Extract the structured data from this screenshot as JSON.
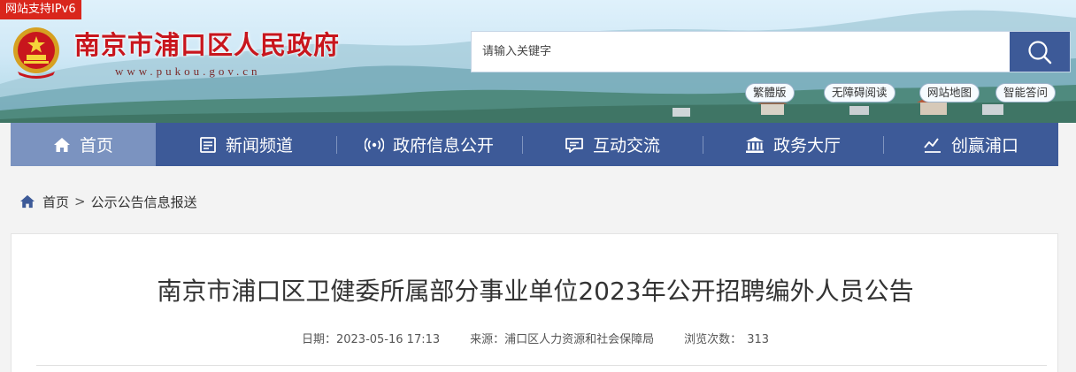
{
  "badge": {
    "ipv6": "网站支持IPv6"
  },
  "site": {
    "title": "南京市浦口区人民政府",
    "domain": "www.pukou.gov.cn"
  },
  "search": {
    "placeholder": "请输入关键字",
    "icon": "search-icon"
  },
  "quick_links": [
    "繁體版",
    "无障碍阅读",
    "网站地图",
    "智能答问"
  ],
  "nav": [
    {
      "label": "首页",
      "icon": "home-icon",
      "active": true
    },
    {
      "label": "新闻频道",
      "icon": "newspaper-icon"
    },
    {
      "label": "政府信息公开",
      "icon": "broadcast-icon"
    },
    {
      "label": "互动交流",
      "icon": "chat-icon"
    },
    {
      "label": "政务大厅",
      "icon": "building-icon"
    },
    {
      "label": "创赢浦口",
      "icon": "chart-icon"
    }
  ],
  "breadcrumb": {
    "home": "首页",
    "separator": ">",
    "current": "公示公告信息报送"
  },
  "article": {
    "title": "南京市浦口区卫健委所属部分事业单位2023年公开招聘编外人员公告",
    "date_label": "日期：",
    "date": "2023-05-16 17:13",
    "source_label": "来源：",
    "source": "浦口区人力资源和社会保障局",
    "views_label": "浏览次数：",
    "views": "313"
  },
  "colors": {
    "nav_bg": "#3d5a98",
    "nav_active": "#7b93c0",
    "title_red": "#c8161d",
    "badge_red": "#d9261c"
  }
}
